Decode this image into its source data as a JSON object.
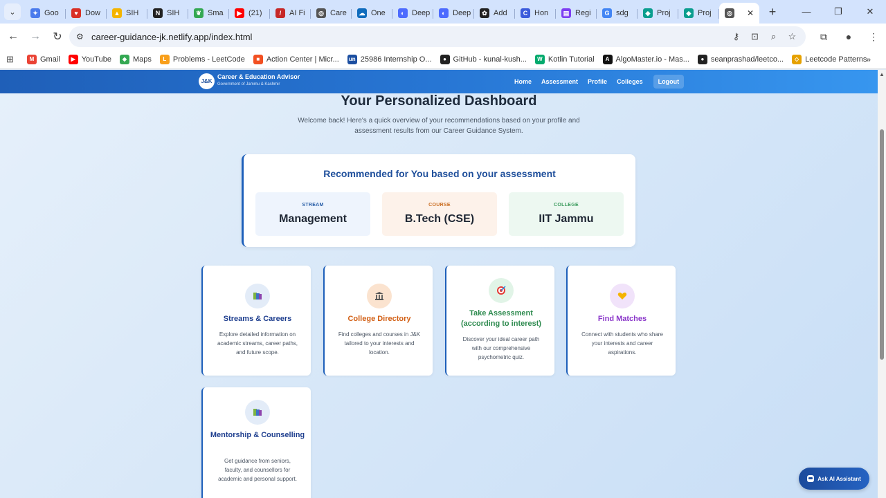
{
  "browser": {
    "tabs": [
      {
        "title": "Goo",
        "icon": "gemini-icon",
        "color": "#4b7bec"
      },
      {
        "title": "Dow",
        "icon": "heart-icon",
        "color": "#d93025"
      },
      {
        "title": "SIH",
        "icon": "drive-icon",
        "color": "#f4b400"
      },
      {
        "title": "SIH",
        "icon": "notion-icon",
        "color": "#222222"
      },
      {
        "title": "Sma",
        "icon": "leaf-icon",
        "color": "#34a853"
      },
      {
        "title": "(21)",
        "icon": "youtube-icon",
        "color": "#ff0000"
      },
      {
        "title": "AI Fi",
        "icon": "ai-icon",
        "color": "#c62828"
      },
      {
        "title": "Care",
        "icon": "globe-icon",
        "color": "#555555"
      },
      {
        "title": "One",
        "icon": "cloud-icon",
        "color": "#0f6cbd"
      },
      {
        "title": "Deep",
        "icon": "deepseek-icon",
        "color": "#4d6bfe"
      },
      {
        "title": "Deep",
        "icon": "deepseek-icon",
        "color": "#4d6bfe"
      },
      {
        "title": "Add",
        "icon": "openai-icon",
        "color": "#222222"
      },
      {
        "title": "Hon",
        "icon": "c-icon",
        "color": "#3b5bdb"
      },
      {
        "title": "Regi",
        "icon": "form-icon",
        "color": "#7e3ff2"
      },
      {
        "title": "sdg",
        "icon": "google-icon",
        "color": "#4285f4"
      },
      {
        "title": "Proj",
        "icon": "diamond-icon",
        "color": "#0b9e8f"
      },
      {
        "title": "Proj",
        "icon": "diamond-icon",
        "color": "#0b9e8f"
      }
    ],
    "url": "career-guidance-jk.netlify.app/index.html",
    "bookmarks": [
      {
        "label": "Gmail",
        "icon": "gmail-icon",
        "color": "#ea4335",
        "glyph": "M"
      },
      {
        "label": "YouTube",
        "icon": "youtube-icon",
        "color": "#ff0000",
        "glyph": "▶"
      },
      {
        "label": "Maps",
        "icon": "maps-icon",
        "color": "#34a853",
        "glyph": "◆"
      },
      {
        "label": "Problems - LeetCode",
        "icon": "leetcode-icon",
        "color": "#f89f1b",
        "glyph": "L"
      },
      {
        "label": "Action Center | Micr...",
        "icon": "microsoft-icon",
        "color": "#f25022",
        "glyph": "■"
      },
      {
        "label": "25986 Internship O...",
        "icon": "unstop-icon",
        "color": "#1c4fa1",
        "glyph": "un"
      },
      {
        "label": "GitHub - kunal-kush...",
        "icon": "github-icon",
        "color": "#222222",
        "glyph": "●"
      },
      {
        "label": "Kotlin Tutorial",
        "icon": "w3schools-icon",
        "color": "#04aa6d",
        "glyph": "W"
      },
      {
        "label": "AlgoMaster.io - Mas...",
        "icon": "algomaster-icon",
        "color": "#111111",
        "glyph": "A"
      },
      {
        "label": "seanprashad/leetco...",
        "icon": "github-icon",
        "color": "#222222",
        "glyph": "●"
      },
      {
        "label": "Leetcode Patterns",
        "icon": "leetcode-patterns-icon",
        "color": "#e6a100",
        "glyph": "◇"
      }
    ]
  },
  "site": {
    "logo_text": "J&K",
    "brand_title": "Career & Education Advisor",
    "brand_subtitle": "Government of Jammu & Kashmir",
    "nav": {
      "home": "Home",
      "assessment": "Assessment",
      "profile": "Profile",
      "colleges": "Colleges",
      "logout": "Logout"
    }
  },
  "dashboard": {
    "title": "Your Personalized Dashboard",
    "description": "Welcome back! Here's a quick overview of your recommendations based on your profile and assessment results from our Career Guidance System.",
    "recommendation": {
      "title": "Recommended for You based on your assessment",
      "stream_label": "STREAM",
      "stream_value": "Management",
      "course_label": "COURSE",
      "course_value": "B.Tech (CSE)",
      "college_label": "COLLEGE",
      "college_value": "IIT Jammu"
    },
    "features": [
      {
        "title": "Streams & Careers",
        "desc": "Explore detailed information on academic streams, career paths, and future scope.",
        "icon": "books-icon",
        "color": "#1f3f8f"
      },
      {
        "title": "College Directory",
        "desc": "Find colleges and courses in J&K tailored to your interests and location.",
        "icon": "bank-icon",
        "color": "#d25f14"
      },
      {
        "title": "Take Assessment (according to interest)",
        "desc": "Discover your ideal career path with our comprehensive psychometric quiz.",
        "icon": "target-icon",
        "color": "#2d8a4e"
      },
      {
        "title": "Find Matches",
        "desc": "Connect with students who share your interests and career aspirations.",
        "icon": "heart-hands-icon",
        "color": "#8a35c9"
      },
      {
        "title": "Mentorship & Counselling",
        "desc": "Get guidance from seniors, faculty, and counsellors for academic and personal support.",
        "icon": "books-icon",
        "color": "#1f3f8f"
      }
    ]
  },
  "assistant": {
    "label": "Ask AI Assistant"
  }
}
